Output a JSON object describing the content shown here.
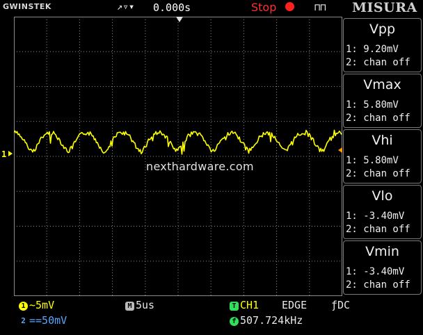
{
  "header": {
    "brand": "GWINSTEK",
    "trigger_icon": "trigger-mode-icon",
    "timebase_offset": "0.000s",
    "run_status": "Stop",
    "misura_label": "MISURA"
  },
  "measurements": [
    {
      "name": "Vpp",
      "ch1": "1: 9.20mV",
      "ch2": "2: chan off"
    },
    {
      "name": "Vmax",
      "ch1": "1: 5.80mV",
      "ch2": "2: chan off"
    },
    {
      "name": "Vhi",
      "ch1": "1: 5.80mV",
      "ch2": "2: chan off"
    },
    {
      "name": "Vlo",
      "ch1": "1: -3.40mV",
      "ch2": "2: chan off"
    },
    {
      "name": "Vmin",
      "ch1": "1: -3.40mV",
      "ch2": "2: chan off"
    }
  ],
  "channel_marker": "1",
  "watermark": "nexthardware.com",
  "status": {
    "ch1_num": "1",
    "ch1_scale": "~5mV",
    "ch2_num": "2",
    "ch2_scale": "==50mV",
    "time_badge": "M",
    "time_scale": "5us",
    "trig_badge": "T",
    "trig_source": "CH1",
    "trig_type": "EDGE",
    "trig_coupling": "ƒDC",
    "freq_badge": "f",
    "frequency": "507.724kHz"
  },
  "colors": {
    "trace": "#ffff00",
    "grid": "#8a8a8a",
    "stop": "#ff3030"
  }
}
